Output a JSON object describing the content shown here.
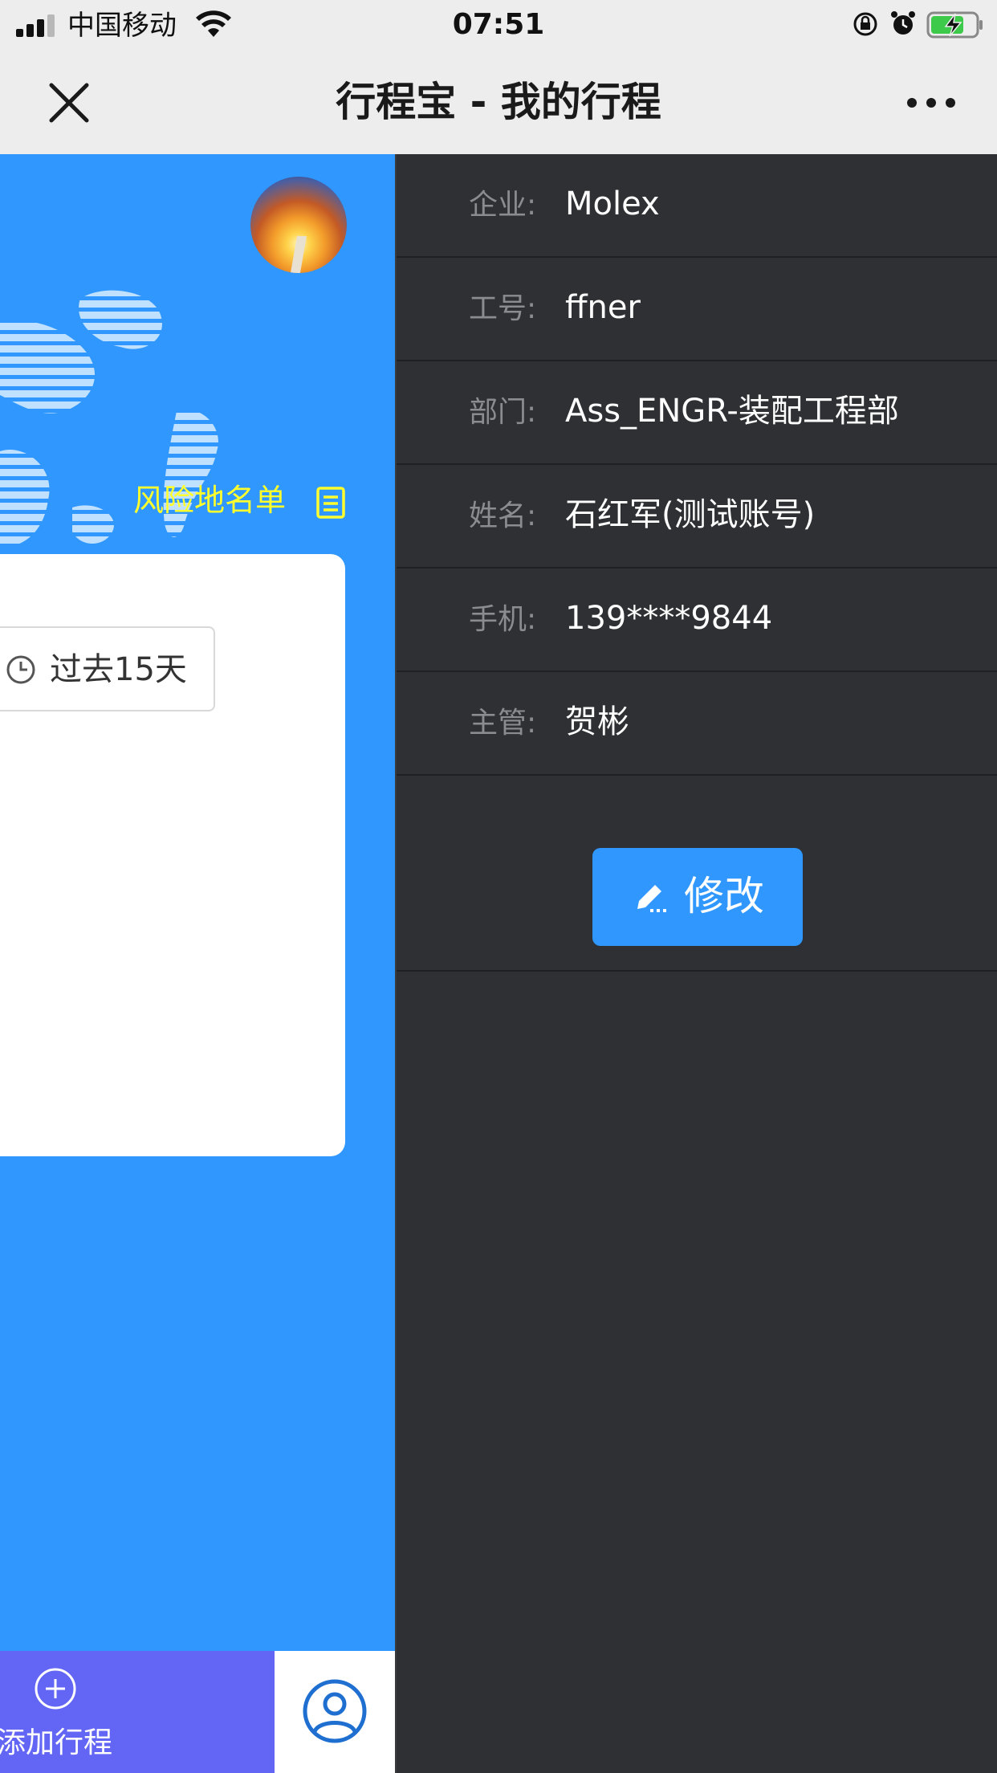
{
  "status_bar": {
    "carrier": "中国移动",
    "time": "07:51"
  },
  "nav": {
    "title": "行程宝 - 我的行程"
  },
  "main": {
    "risk_list_label": "风险地名单",
    "range_label": "过去15天"
  },
  "tabs": {
    "add_trip_label": "添加行程"
  },
  "profile": {
    "rows": [
      {
        "label": "企业:",
        "value": "Molex"
      },
      {
        "label": "工号:",
        "value": "ffner"
      },
      {
        "label": "部门:",
        "value": "Ass_ENGR-装配工程部"
      },
      {
        "label": "姓名:",
        "value": "石红军(测试账号)"
      },
      {
        "label": "手机:",
        "value": "139****9844"
      },
      {
        "label": "主管:",
        "value": "贺彬"
      }
    ],
    "edit_label": "修改"
  },
  "colors": {
    "primary_blue": "#2f97fe",
    "risk_yellow": "#ffff2e",
    "tab_purple": "#6366f5",
    "drawer_bg": "#2f3034"
  },
  "icons": {
    "close": "close-icon",
    "more": "more-icon",
    "risk": "clipboard-icon",
    "clock": "clock-icon",
    "add": "plus-circle-icon",
    "me": "user-icon",
    "edit": "pencil-icon"
  }
}
